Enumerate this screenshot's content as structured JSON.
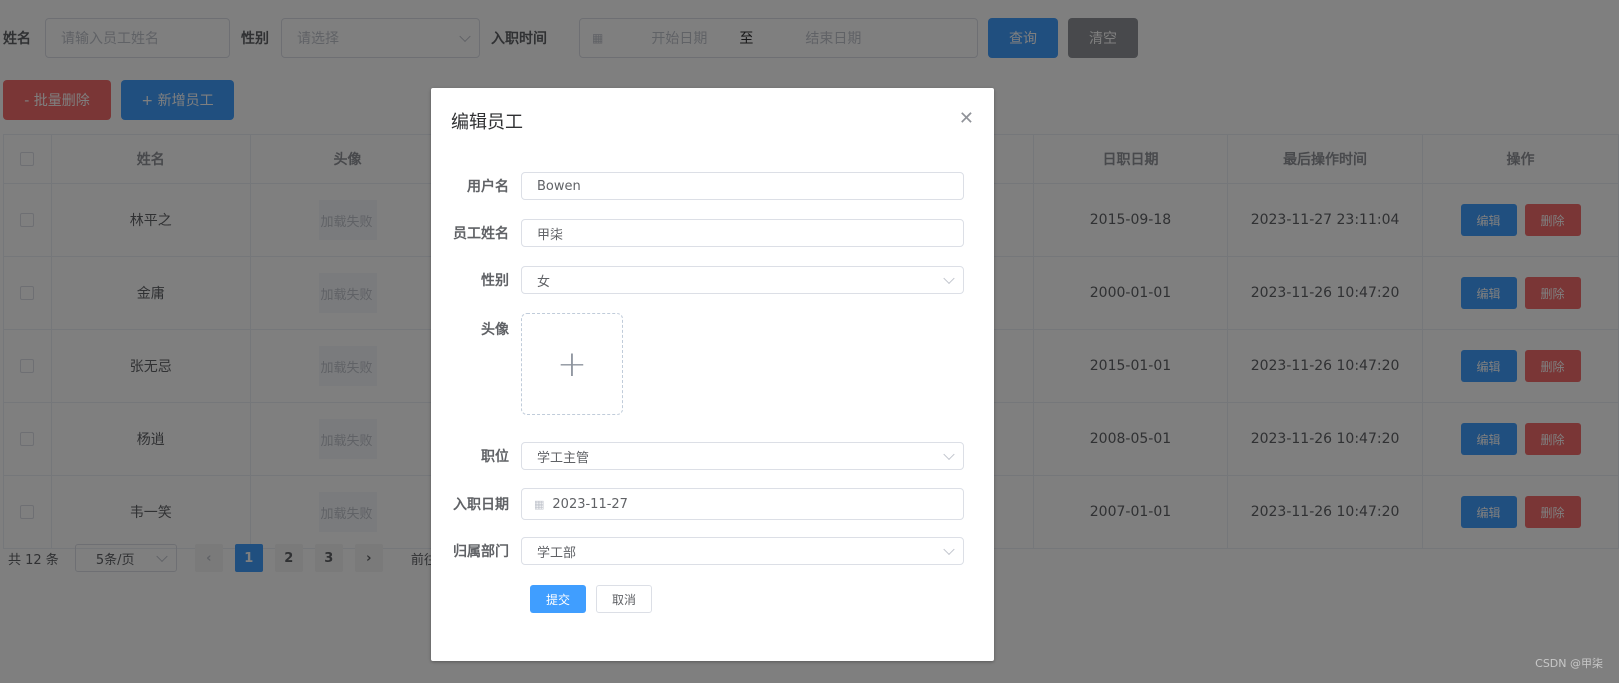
{
  "search": {
    "name_label": "姓名",
    "name_placeholder": "请输入员工姓名",
    "gender_label": "性别",
    "gender_placeholder": "请选择",
    "entry_label": "入职时间",
    "start_placeholder": "开始日期",
    "range_sep": "至",
    "end_placeholder": "结束日期",
    "query_btn": "查询",
    "clear_btn": "清空"
  },
  "actions": {
    "batch_delete": "- 批量删除",
    "add_employee": "+ 新增员工"
  },
  "table": {
    "headers": [
      "姓名",
      "头像",
      "日职日期",
      "最后操作时间",
      "操作"
    ],
    "edit_label": "编辑",
    "delete_label": "删除",
    "img_fail": "加载失败",
    "rows": [
      {
        "name": "林平之",
        "entry": "2015-09-18",
        "updated": "2023-11-27 23:11:04"
      },
      {
        "name": "金庸",
        "entry": "2000-01-01",
        "updated": "2023-11-26 10:47:20"
      },
      {
        "name": "张无忌",
        "entry": "2015-01-01",
        "updated": "2023-11-26 10:47:20"
      },
      {
        "name": "杨逍",
        "entry": "2008-05-01",
        "updated": "2023-11-26 10:47:20"
      },
      {
        "name": "韦一笑",
        "entry": "2007-01-01",
        "updated": "2023-11-26 10:47:20"
      }
    ]
  },
  "pager": {
    "total": "共 12 条",
    "page_size": "5条/页",
    "pages": [
      "1",
      "2",
      "3"
    ],
    "goto": "前往"
  },
  "dialog": {
    "title": "编辑员工",
    "username_label": "用户名",
    "username_value": "Bowen",
    "name_label": "员工姓名",
    "name_value": "甲柒",
    "gender_label": "性别",
    "gender_value": "女",
    "avatar_label": "头像",
    "position_label": "职位",
    "position_value": "学工主管",
    "entry_label": "入职日期",
    "entry_value": "2023-11-27",
    "dept_label": "归属部门",
    "dept_value": "学工部",
    "submit": "提交",
    "cancel": "取消"
  },
  "watermark": "CSDN @甲柒",
  "colors": {
    "primary": "#409eff",
    "danger": "#f56c6c",
    "info": "#909399"
  }
}
